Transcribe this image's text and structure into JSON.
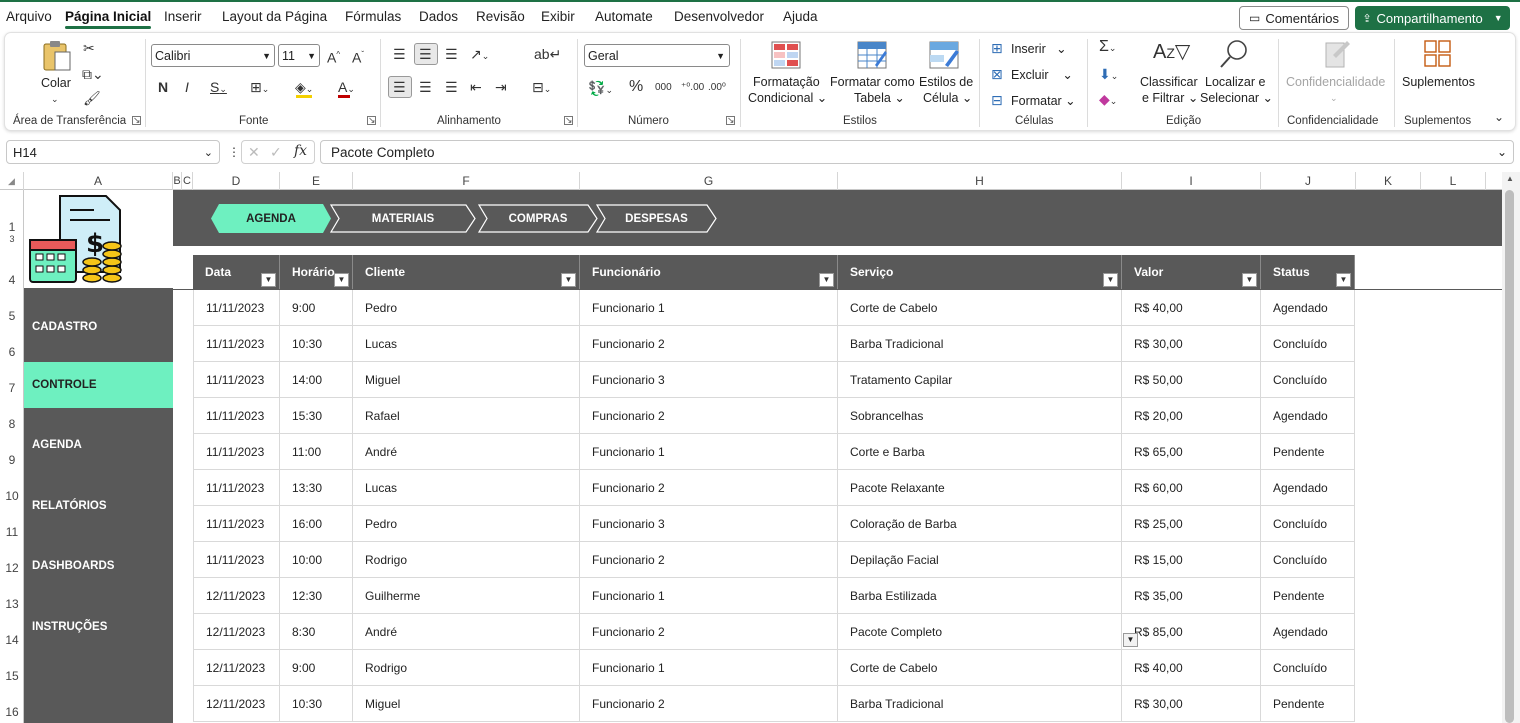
{
  "menu": {
    "items": [
      "Arquivo",
      "Página Inicial",
      "Inserir",
      "Layout da Página",
      "Fórmulas",
      "Dados",
      "Revisão",
      "Exibir",
      "Automate",
      "Desenvolvedor",
      "Ajuda"
    ],
    "comments": "Comentários",
    "share": "Compartilhamento"
  },
  "ribbon": {
    "paste": "Colar",
    "clipboard_group": "Área de Transferência",
    "font_name": "Calibri",
    "font_size": "11",
    "font_group": "Fonte",
    "align_group": "Alinhamento",
    "number_format": "Geral",
    "number_group": "Número",
    "cond_format_1": "Formatação",
    "cond_format_2": "Condicional",
    "format_table_1": "Formatar como",
    "format_table_2": "Tabela",
    "cell_styles_1": "Estilos de",
    "cell_styles_2": "Célula",
    "styles_group": "Estilos",
    "insert": "Inserir",
    "delete": "Excluir",
    "format": "Formatar",
    "cells_group": "Células",
    "sort_1": "Classificar",
    "sort_2": "e Filtrar",
    "find_1": "Localizar e",
    "find_2": "Selecionar",
    "editing_group": "Edição",
    "sensitivity": "Confidencialidade",
    "sensitivity_group": "Confidencialidade",
    "addins": "Suplementos",
    "addins_group": "Suplementos"
  },
  "formula_bar": {
    "cell_ref": "H14",
    "formula": "Pacote Completo"
  },
  "columns": [
    "A",
    "B",
    "C",
    "D",
    "E",
    "F",
    "G",
    "H",
    "I",
    "J",
    "K",
    "L"
  ],
  "rows": [
    "1",
    "3",
    "4",
    "5",
    "6",
    "7",
    "8",
    "9",
    "10",
    "11",
    "12",
    "13",
    "14",
    "15",
    "16"
  ],
  "tabs": [
    "AGENDA",
    "MATERIAIS",
    "COMPRAS",
    "DESPESAS"
  ],
  "nav": [
    "CADASTRO",
    "CONTROLE",
    "AGENDA",
    "RELATÓRIOS",
    "DASHBOARDS",
    "INSTRUÇÕES"
  ],
  "table": {
    "headers": [
      "Data",
      "Horário",
      "Cliente",
      "Funcionário",
      "Serviço",
      "Valor",
      "Status"
    ],
    "rows": [
      [
        "11/11/2023",
        "9:00",
        "Pedro",
        "Funcionario 1",
        "Corte de Cabelo",
        "R$ 40,00",
        "Agendado"
      ],
      [
        "11/11/2023",
        "10:30",
        "Lucas",
        "Funcionario 2",
        "Barba Tradicional",
        "R$ 30,00",
        "Concluído"
      ],
      [
        "11/11/2023",
        "14:00",
        "Miguel",
        "Funcionario 3",
        "Tratamento Capilar",
        "R$ 50,00",
        "Concluído"
      ],
      [
        "11/11/2023",
        "15:30",
        "Rafael",
        "Funcionario 2",
        "Sobrancelhas",
        "R$ 20,00",
        "Agendado"
      ],
      [
        "11/11/2023",
        "11:00",
        "André",
        "Funcionario 1",
        "Corte e Barba",
        "R$ 65,00",
        "Pendente"
      ],
      [
        "11/11/2023",
        "13:30",
        "Lucas",
        "Funcionario 2",
        "Pacote Relaxante",
        "R$ 60,00",
        "Agendado"
      ],
      [
        "11/11/2023",
        "16:00",
        "Pedro",
        "Funcionario 3",
        "Coloração de Barba",
        "R$ 25,00",
        "Concluído"
      ],
      [
        "11/11/2023",
        "10:00",
        "Rodrigo",
        "Funcionario 2",
        "Depilação Facial",
        "R$ 15,00",
        "Concluído"
      ],
      [
        "12/11/2023",
        "12:30",
        "Guilherme",
        "Funcionario 1",
        "Barba Estilizada",
        "R$ 35,00",
        "Pendente"
      ],
      [
        "12/11/2023",
        "8:30",
        "André",
        "Funcionario 2",
        "Pacote Completo",
        "R$ 85,00",
        "Agendado"
      ],
      [
        "12/11/2023",
        "9:00",
        "Rodrigo",
        "Funcionario 1",
        "Corte de Cabelo",
        "R$ 40,00",
        "Concluído"
      ],
      [
        "12/11/2023",
        "10:30",
        "Miguel",
        "Funcionario 2",
        "Barba Tradicional",
        "R$ 30,00",
        "Pendente"
      ]
    ]
  },
  "colors": {
    "excel_green": "#1e7145",
    "accent": "#6ef0c0",
    "dark": "#595959"
  }
}
